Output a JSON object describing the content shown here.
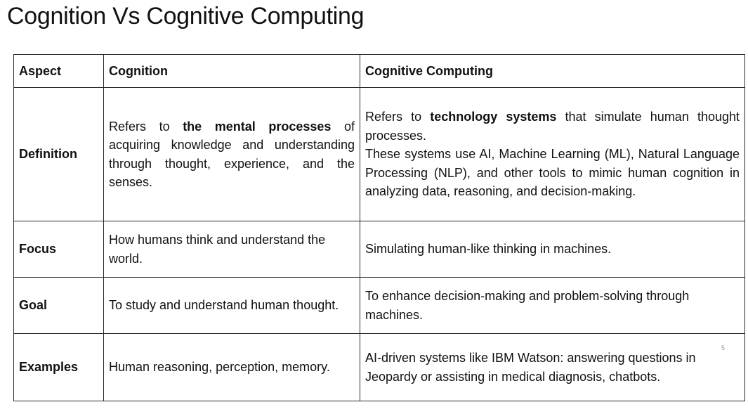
{
  "title": "Cognition Vs Cognitive Computing",
  "table": {
    "headers": {
      "aspect": "Aspect",
      "cognition": "Cognition",
      "cognitive_computing": "Cognitive Computing"
    },
    "rows": [
      {
        "aspect": "Definition",
        "cognition": {
          "pre": "Refers to ",
          "bold": "the mental processes",
          "post": " of acquiring knowledge and understanding through thought, experience, and the senses."
        },
        "cognitive_computing": {
          "pre": "Refers to ",
          "bold": "technology systems",
          "post": " that simulate human thought processes.",
          "line2": "These systems use AI, Machine Learning (ML), Natural Language Processing (NLP), and other tools to mimic human cognition in analyzing data, reasoning, and decision-making."
        }
      },
      {
        "aspect": "Focus",
        "cognition": "How humans think and understand the world.",
        "cognitive_computing": "Simulating human-like thinking in machines."
      },
      {
        "aspect": "Goal",
        "cognition": "To study and understand human thought.",
        "cognitive_computing": "To enhance decision-making and problem-solving through machines."
      },
      {
        "aspect": "Examples",
        "cognition": "Human reasoning, perception, memory.",
        "cognitive_computing": "AI-driven systems like IBM Watson: answering questions in Jeopardy or assisting in medical diagnosis, chatbots."
      }
    ]
  },
  "page_number": "5"
}
